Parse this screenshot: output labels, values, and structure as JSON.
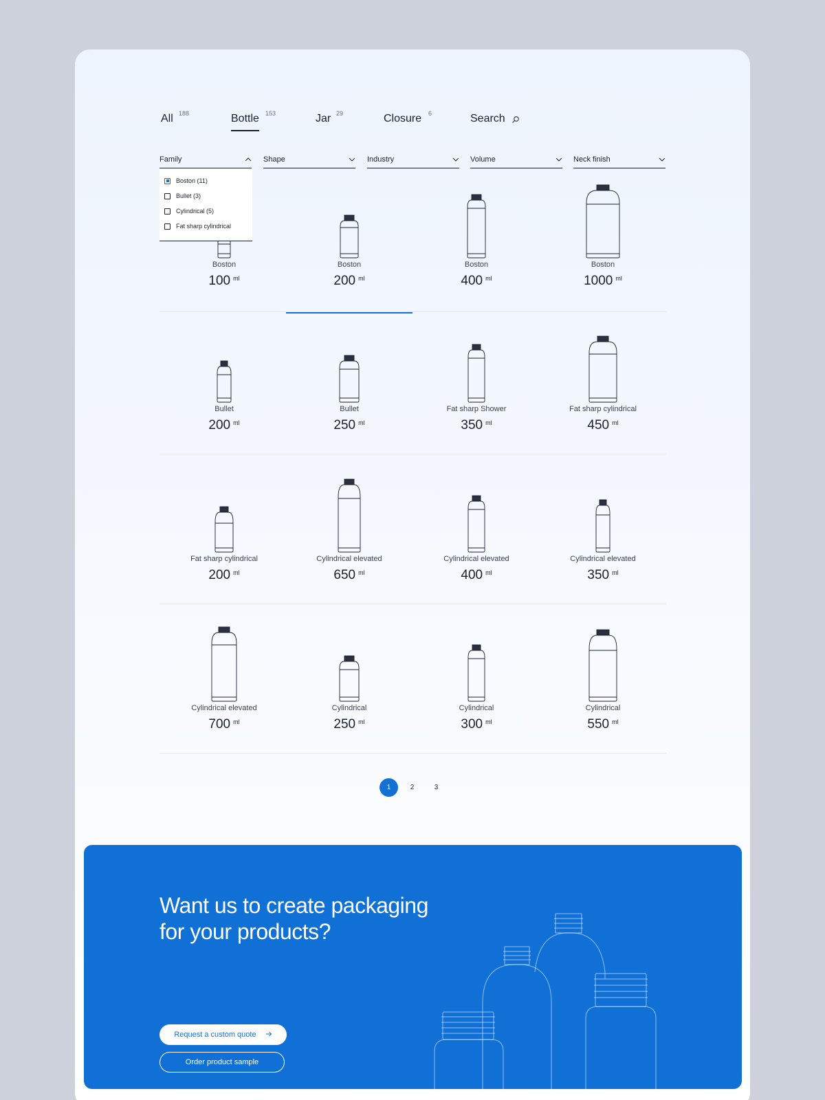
{
  "tabs": [
    {
      "label": "All",
      "count": "188"
    },
    {
      "label": "Bottle",
      "count": "153"
    },
    {
      "label": "Jar",
      "count": "29"
    },
    {
      "label": "Closure",
      "count": "6"
    },
    {
      "label": "Search",
      "icon": "search-icon"
    }
  ],
  "active_tab": "Bottle",
  "filters": [
    {
      "label": "Family",
      "icon": "chevron-up-icon"
    },
    {
      "label": "Shape",
      "icon": "chevron-down-icon"
    },
    {
      "label": "Industry",
      "icon": "chevron-down-icon"
    },
    {
      "label": "Volume",
      "icon": "chevron-down-icon"
    },
    {
      "label": "Neck finish",
      "icon": "chevron-down-icon"
    }
  ],
  "family_options": [
    {
      "label": "Boston (11)",
      "checked": true
    },
    {
      "label": "Bullet (3)",
      "checked": false
    },
    {
      "label": "Cylindrical (5)",
      "checked": false
    },
    {
      "label": "Fat sharp cylindrical",
      "checked": false
    }
  ],
  "products": [
    {
      "name": "Boston",
      "volume": "100",
      "unit": "ml"
    },
    {
      "name": "Boston",
      "volume": "200",
      "unit": "ml"
    },
    {
      "name": "Boston",
      "volume": "400",
      "unit": "ml"
    },
    {
      "name": "Boston",
      "volume": "1000",
      "unit": "ml"
    },
    {
      "name": "Bullet",
      "volume": "200",
      "unit": "ml"
    },
    {
      "name": "Bullet",
      "volume": "250",
      "unit": "ml"
    },
    {
      "name": "Fat sharp Shower",
      "volume": "350",
      "unit": "ml"
    },
    {
      "name": "Fat sharp cylindrical",
      "volume": "450",
      "unit": "ml"
    },
    {
      "name": "Fat sharp cylindrical",
      "volume": "200",
      "unit": "ml"
    },
    {
      "name": "Cylindrical elevated",
      "volume": "650",
      "unit": "ml"
    },
    {
      "name": "Cylindrical elevated",
      "volume": "400",
      "unit": "ml"
    },
    {
      "name": "Cylindrical elevated",
      "volume": "350",
      "unit": "ml"
    },
    {
      "name": "Cylindrical elevated",
      "volume": "700",
      "unit": "ml"
    },
    {
      "name": "Cylindrical",
      "volume": "250",
      "unit": "ml"
    },
    {
      "name": "Cylindrical",
      "volume": "300",
      "unit": "ml"
    },
    {
      "name": "Cylindrical",
      "volume": "550",
      "unit": "ml"
    }
  ],
  "pagination": {
    "pages": [
      "1",
      "2",
      "3"
    ],
    "current": "1"
  },
  "cta": {
    "title_line1": "Want us to create packaging",
    "title_line2": "for your products?",
    "quote_button": "Request a custom quote",
    "quote_icon": "arrow-right-icon",
    "sample_button": "Order product sample"
  },
  "colors": {
    "accent": "#1570d4",
    "cta_bg": "#1070d6",
    "ink": "#1a1f2e",
    "page_bg": "#ccd1dc"
  }
}
